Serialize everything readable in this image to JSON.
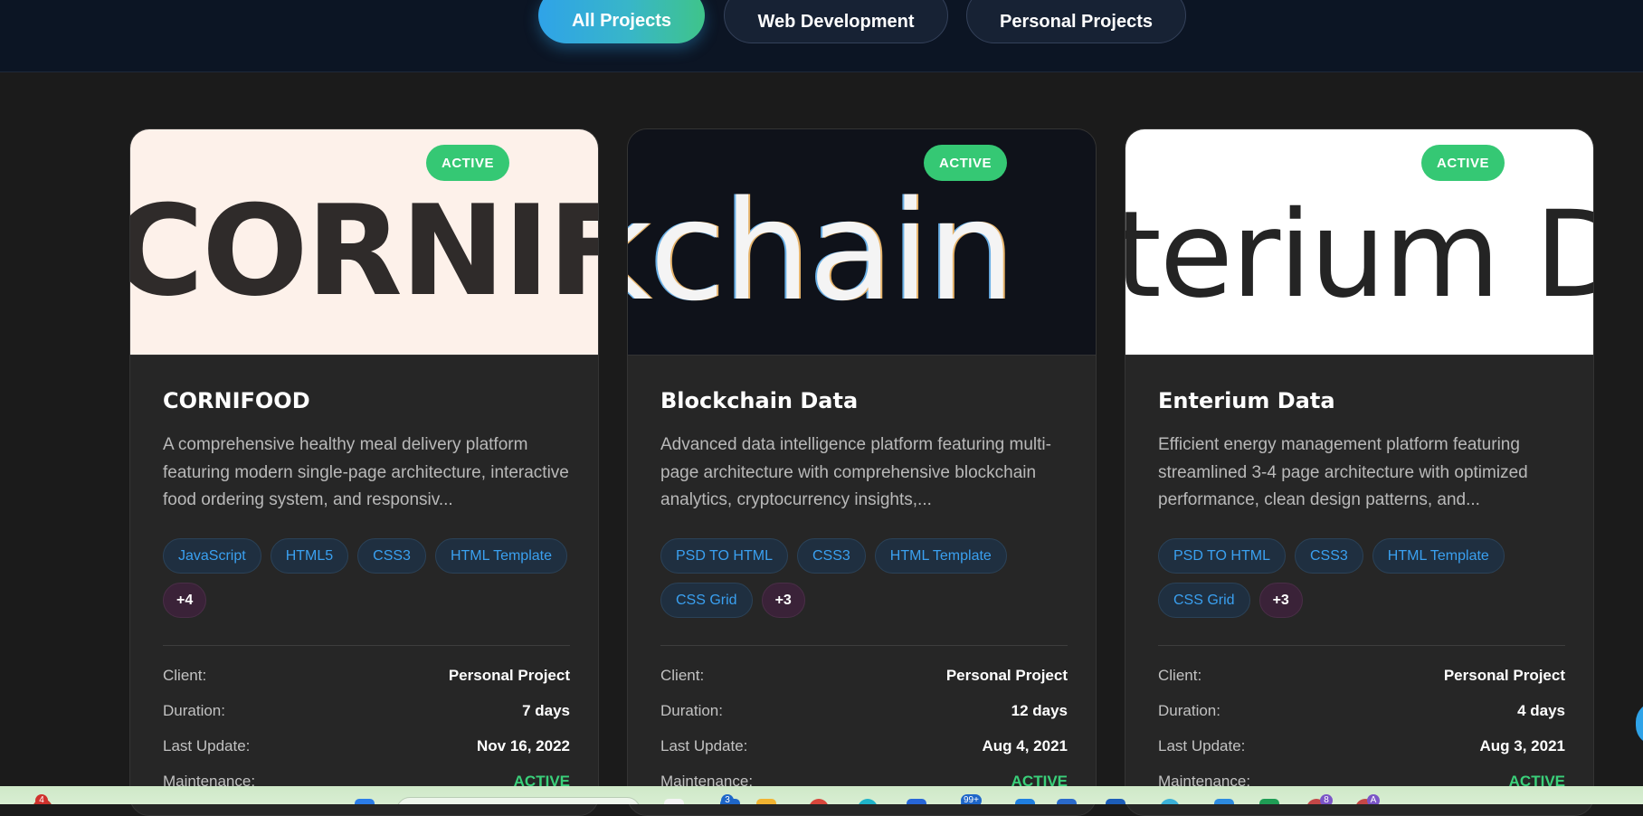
{
  "filters": [
    {
      "label": "All Projects",
      "active": true
    },
    {
      "label": "Web Development",
      "active": false
    },
    {
      "label": "Personal Projects",
      "active": false
    }
  ],
  "cards": [
    {
      "image_text": "CORNIF",
      "status": "ACTIVE",
      "title": "CORNIFOOD",
      "description": "A comprehensive healthy meal delivery platform featuring modern single-page architecture, interactive food ordering system, and responsiv...",
      "tags": [
        "JavaScript",
        "HTML5",
        "CSS3",
        "HTML Template"
      ],
      "more": "+4",
      "meta": {
        "client_label": "Client:",
        "client": "Personal Project",
        "duration_label": "Duration:",
        "duration": "7 days",
        "update_label": "Last Update:",
        "update": "Nov 16, 2022",
        "maintenance_label": "Maintenance:",
        "maintenance": "ACTIVE"
      }
    },
    {
      "image_text": "kchain",
      "status": "ACTIVE",
      "title": "Blockchain Data",
      "description": "Advanced data intelligence platform featuring multi-page architecture with comprehensive blockchain analytics, cryptocurrency insights,...",
      "tags": [
        "PSD TO HTML",
        "CSS3",
        "HTML Template",
        "CSS Grid"
      ],
      "more": "+3",
      "meta": {
        "client_label": "Client:",
        "client": "Personal Project",
        "duration_label": "Duration:",
        "duration": "12 days",
        "update_label": "Last Update:",
        "update": "Aug 4, 2021",
        "maintenance_label": "Maintenance:",
        "maintenance": "ACTIVE"
      }
    },
    {
      "image_text": "terium De",
      "status": "ACTIVE",
      "title": "Enterium Data",
      "description": "Efficient energy management platform featuring streamlined 3-4 page architecture with optimized performance, clean design patterns, and...",
      "tags": [
        "PSD TO HTML",
        "CSS3",
        "HTML Template",
        "CSS Grid"
      ],
      "more": "+3",
      "meta": {
        "client_label": "Client:",
        "client": "Personal Project",
        "duration_label": "Duration:",
        "duration": "4 days",
        "update_label": "Last Update:",
        "update": "Aug 3, 2021",
        "maintenance_label": "Maintenance:",
        "maintenance": "ACTIVE"
      }
    }
  ],
  "taskbar": {
    "badges": [
      "4",
      "3",
      "99+",
      "8",
      "A"
    ]
  },
  "colors": {
    "active_green": "#35c874",
    "tag_blue": "#3aa0f0",
    "accent_gradient_start": "#2fa3e8",
    "accent_gradient_end": "#3fc48a"
  }
}
